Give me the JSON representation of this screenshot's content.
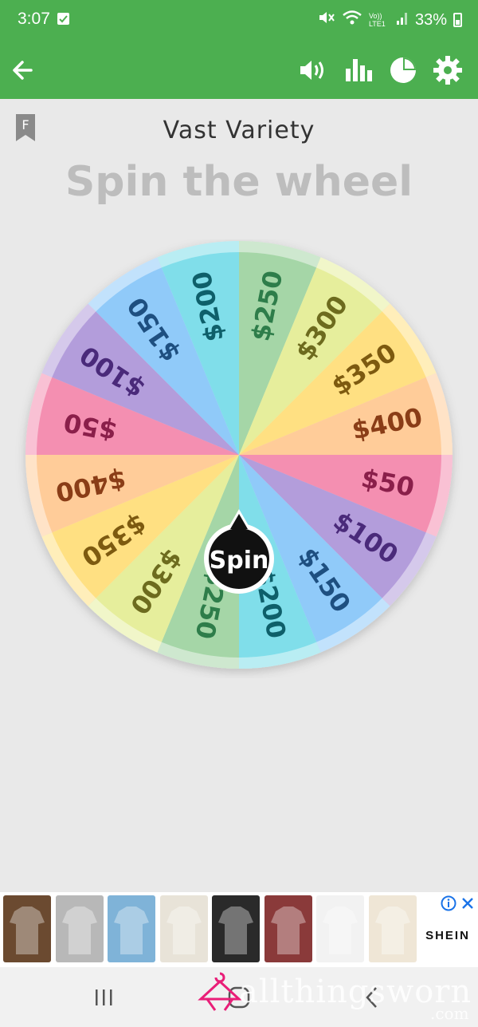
{
  "status_bar": {
    "time": "3:07",
    "battery": "33%",
    "volte_label": "Vo)) LTE1",
    "icons": [
      "check-icon",
      "mute-icon",
      "wifi-icon",
      "signal-icon",
      "battery-icon"
    ]
  },
  "app_bar": {
    "icons": [
      "back-arrow-icon",
      "volume-icon",
      "bar-chart-icon",
      "pie-chart-icon",
      "gear-icon"
    ],
    "color": "#4caf50"
  },
  "wheel_name": "Vast Variety",
  "heading": "Spin the wheel",
  "bookmark_letter": "F",
  "wheel": {
    "spin_label": "Spin",
    "segments": [
      {
        "label": "$250",
        "color": "#a5d6a7",
        "text_color": "#2e7d4a"
      },
      {
        "label": "$300",
        "color": "#e6ee9c",
        "text_color": "#6d6b1e"
      },
      {
        "label": "$350",
        "color": "#ffe082",
        "text_color": "#7d5a10"
      },
      {
        "label": "$400",
        "color": "#ffcc99",
        "text_color": "#8a3d17"
      },
      {
        "label": "$50",
        "color": "#f48fb1",
        "text_color": "#8a1f4a"
      },
      {
        "label": "$100",
        "color": "#b39ddb",
        "text_color": "#4a2a7a"
      },
      {
        "label": "$150",
        "color": "#90caf9",
        "text_color": "#1e4f80"
      },
      {
        "label": "$200",
        "color": "#80deea",
        "text_color": "#0e5f6a"
      },
      {
        "label": "$250",
        "color": "#a5d6a7",
        "text_color": "#2e7d4a"
      },
      {
        "label": "$300",
        "color": "#e6ee9c",
        "text_color": "#6d6b1e"
      },
      {
        "label": "$350",
        "color": "#ffe082",
        "text_color": "#7d5a10"
      },
      {
        "label": "$400",
        "color": "#ffcc99",
        "text_color": "#8a3d17"
      },
      {
        "label": "$50",
        "color": "#f48fb1",
        "text_color": "#8a1f4a"
      },
      {
        "label": "$100",
        "color": "#b39ddb",
        "text_color": "#4a2a7a"
      },
      {
        "label": "$150",
        "color": "#90caf9",
        "text_color": "#1e4f80"
      },
      {
        "label": "$200",
        "color": "#80deea",
        "text_color": "#0e5f6a"
      }
    ]
  },
  "ad": {
    "brand": "SHEIN",
    "items": [
      {
        "name": "ad-item-graphic-tshirt",
        "bg": "#6b4a30"
      },
      {
        "name": "ad-item-jeans",
        "bg": "#b8b8b8"
      },
      {
        "name": "ad-item-blue-jacket",
        "bg": "#7fb3d8"
      },
      {
        "name": "ad-item-white-cardigan",
        "bg": "#e8e3d8"
      },
      {
        "name": "ad-item-black-set",
        "bg": "#2a2a2a"
      },
      {
        "name": "ad-item-polo-shirts",
        "bg": "#8a3a3a"
      },
      {
        "name": "ad-item-white-tshirt",
        "bg": "#f2f2f2"
      },
      {
        "name": "ad-item-print-tshirt",
        "bg": "#efe6d6"
      }
    ],
    "icons": [
      "ad-info-icon",
      "ad-close-icon"
    ]
  },
  "nav_bar": {
    "icons": [
      "recents-icon",
      "home-icon",
      "back-nav-icon"
    ]
  },
  "watermark": {
    "text": "allthingsworn",
    "suffix": ".com"
  }
}
